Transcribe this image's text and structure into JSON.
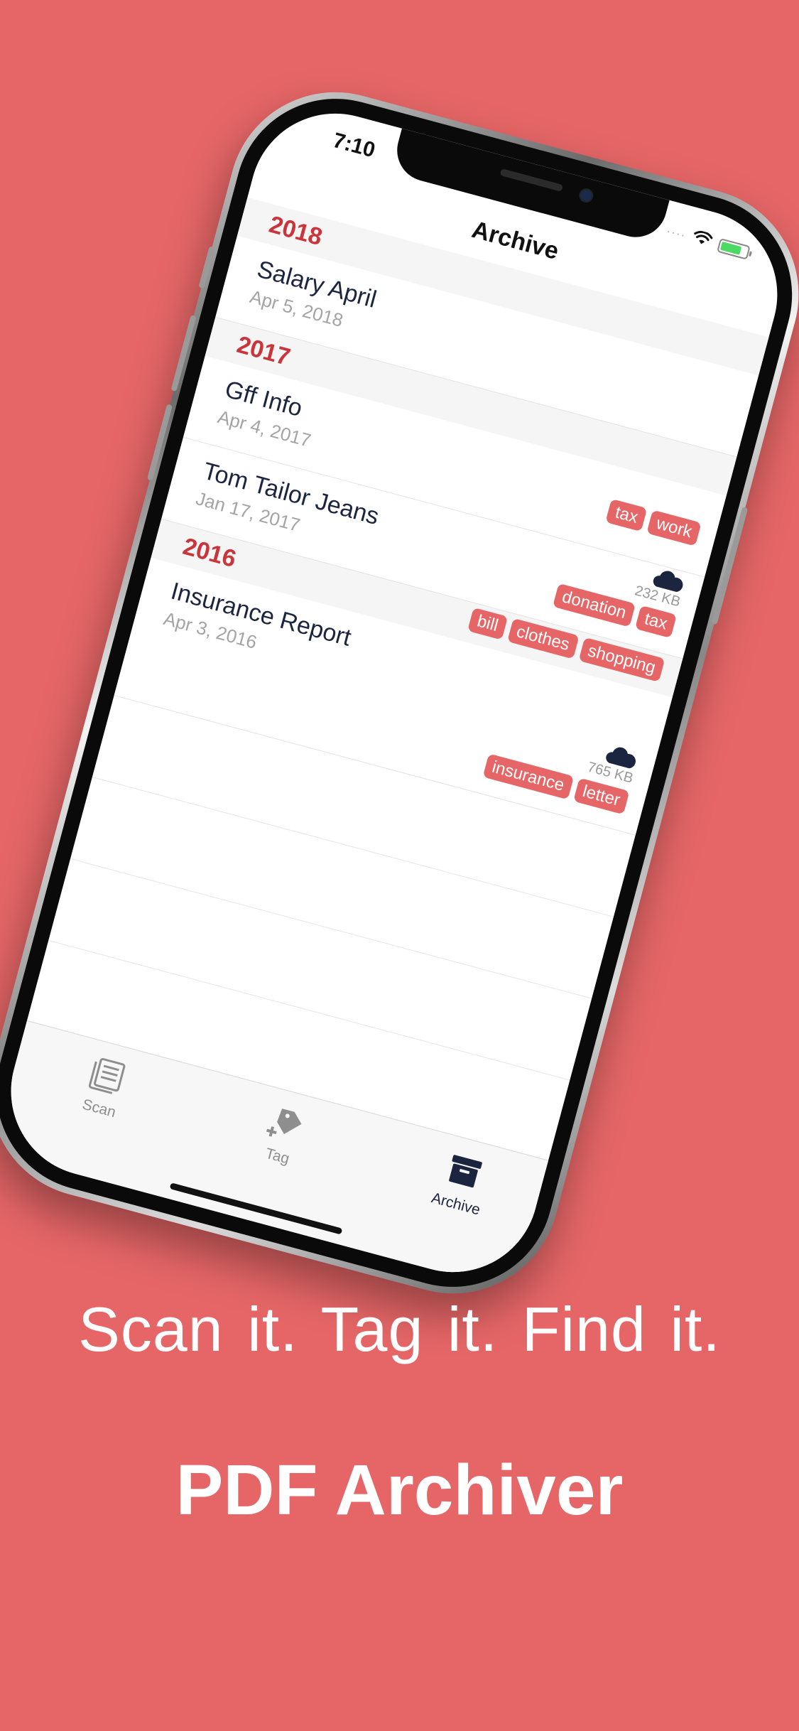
{
  "status_bar": {
    "time": "7:10",
    "signal": "····"
  },
  "nav": {
    "title": "Archive"
  },
  "sections": [
    {
      "year": "2018",
      "rows": [
        {
          "title": "Salary April",
          "date": "Apr 5, 2018",
          "cloud": false,
          "size": "",
          "tags": []
        }
      ]
    },
    {
      "year": "2017",
      "rows": [
        {
          "title": "Gff Info",
          "date": "Apr 4, 2017",
          "cloud": false,
          "size": "",
          "tags": [
            "tax",
            "work"
          ]
        },
        {
          "title": "Tom Tailor Jeans",
          "date": "Jan 17, 2017",
          "cloud": true,
          "size": "232 KB",
          "tags": [
            "donation",
            "tax"
          ]
        }
      ]
    },
    {
      "year": "2016",
      "rows": [
        {
          "title": "Insurance Report",
          "date": "Apr 3, 2016",
          "cloud": true,
          "size": "765 KB",
          "tags": [
            "bill",
            "clothes",
            "shopping",
            "insurance",
            "letter"
          ]
        }
      ]
    }
  ],
  "tab_bar": {
    "scan": "Scan",
    "tag": "Tag",
    "archive": "Archive"
  },
  "marketing": {
    "tagline": "Scan it.  Tag it.  Find it.",
    "app_name": "PDF Archiver"
  },
  "colors": {
    "background": "#E66667",
    "accent": "#c9353a",
    "tag": "#E66667"
  }
}
